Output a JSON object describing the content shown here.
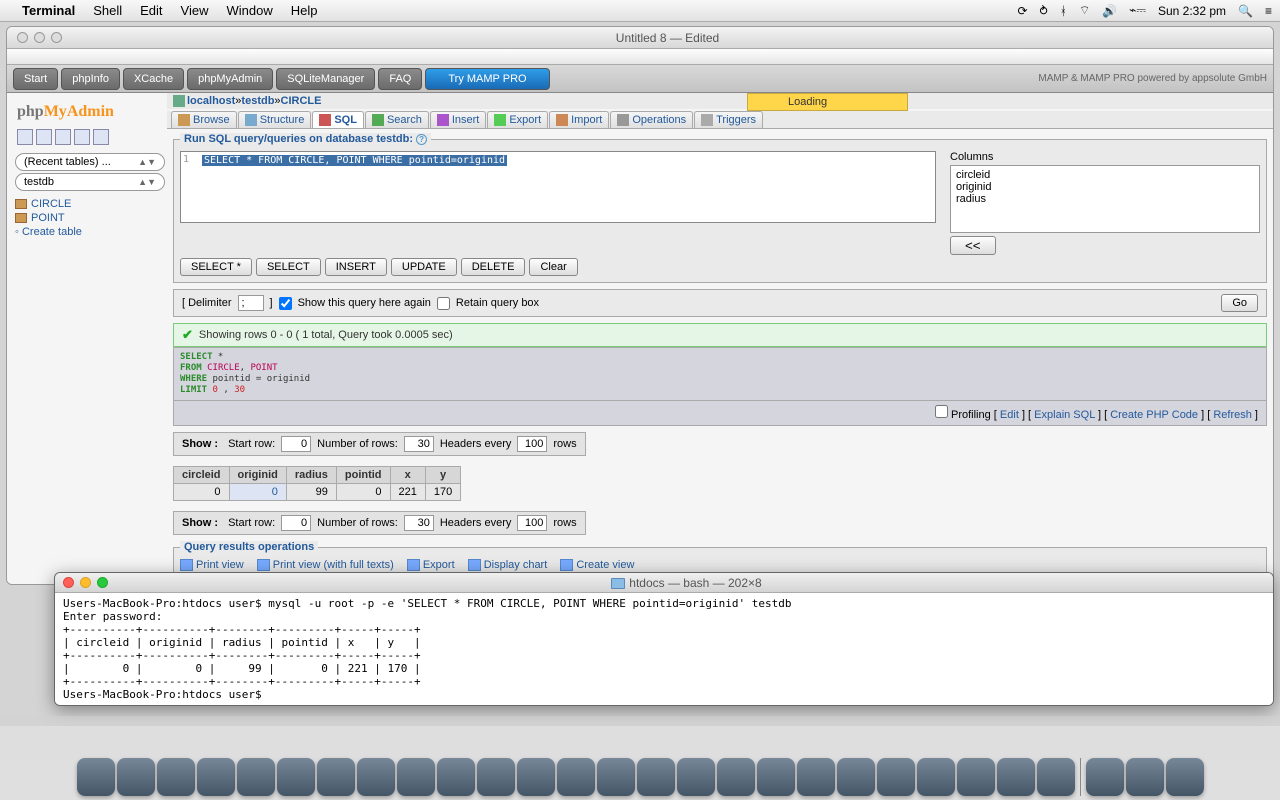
{
  "menubar": {
    "app": "Terminal",
    "items": [
      "Shell",
      "Edit",
      "View",
      "Window",
      "Help"
    ],
    "time": "Sun 2:32 pm"
  },
  "window1": {
    "title": "Untitled 8 — Edited"
  },
  "mamp_tabs": [
    "Start",
    "phpInfo",
    "XCache",
    "phpMyAdmin",
    "SQLiteManager",
    "FAQ"
  ],
  "mamp_try": "Try MAMP PRO",
  "powered": "MAMP & MAMP PRO powered by appsolute GmbH",
  "pma": {
    "logo_php": "php",
    "logo_my": "My",
    "logo_admin": "Admin",
    "recent": "(Recent tables) ...",
    "db": "testdb",
    "tables": [
      "CIRCLE",
      "POINT"
    ],
    "create": "Create table",
    "crumb_host": "localhost",
    "crumb_db": "testdb",
    "crumb_tbl": "CIRCLE",
    "loading": "Loading",
    "tabs": [
      "Browse",
      "Structure",
      "SQL",
      "Search",
      "Insert",
      "Export",
      "Import",
      "Operations",
      "Triggers"
    ],
    "legend": "Run SQL query/queries on database ",
    "legend_db": "testdb:",
    "editor": "SELECT * FROM CIRCLE, POINT WHERE pointid=originid",
    "columns_hdr": "Columns",
    "columns": [
      "circleid",
      "originid",
      "radius"
    ],
    "col_insert": "<<",
    "qbtns": [
      "SELECT *",
      "SELECT",
      "INSERT",
      "UPDATE",
      "DELETE",
      "Clear"
    ],
    "delimiter_lbl": "[ Delimiter",
    "delimiter_val": ";",
    "show_again": "Show this query here again",
    "retain": "Retain query box",
    "go": "Go",
    "ok": "Showing rows 0 - 0 ( 1 total, Query took 0.0005 sec)",
    "sql_pretty": "SELECT *\nFROM CIRCLE, POINT\nWHERE pointid = originid\nLIMIT 0 , 30",
    "profiling": "Profiling",
    "edit": "Edit",
    "explain": "Explain SQL",
    "createphp": "Create PHP Code",
    "refresh": "Refresh",
    "show": "Show :",
    "startrow": "Start row:",
    "startrow_v": "0",
    "numrows": "Number of rows:",
    "numrows_v": "30",
    "headers": "Headers every",
    "headers_v": "100",
    "rows": "rows",
    "rescols": [
      "circleid",
      "originid",
      "radius",
      "pointid",
      "x",
      "y"
    ],
    "resrow": [
      "0",
      "0",
      "99",
      "0",
      "221",
      "170"
    ],
    "qops_legend": "Query results operations",
    "qops": [
      "Print view",
      "Print view (with full texts)",
      "Export",
      "Display chart",
      "Create view"
    ]
  },
  "terminal": {
    "title": "htdocs — bash — 202×8",
    "body": "Users-MacBook-Pro:htdocs user$ mysql -u root -p -e 'SELECT * FROM CIRCLE, POINT WHERE pointid=originid' testdb\nEnter password:\n+----------+----------+--------+---------+-----+-----+\n| circleid | originid | radius | pointid | x   | y   |\n+----------+----------+--------+---------+-----+-----+\n|        0 |        0 |     99 |       0 | 221 | 170 |\n+----------+----------+--------+---------+-----+-----+\nUsers-MacBook-Pro:htdocs user$ "
  }
}
